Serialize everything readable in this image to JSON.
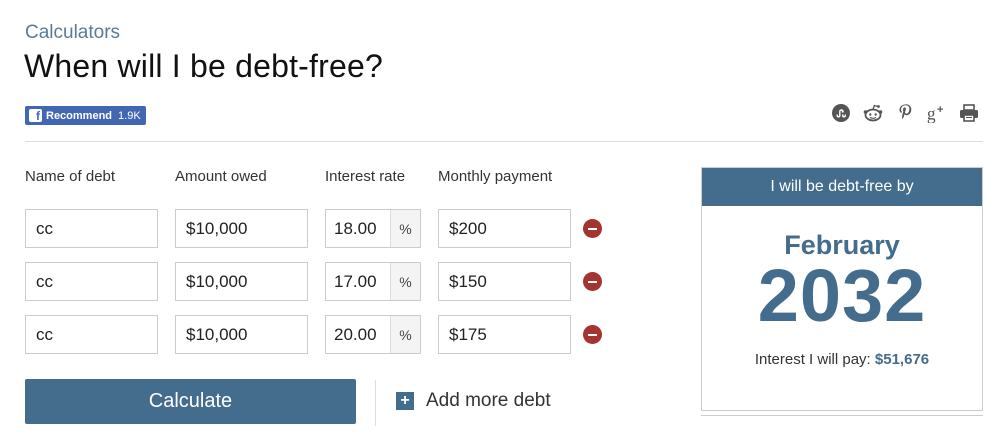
{
  "breadcrumb": "Calculators",
  "title": "When will I be debt-free?",
  "facebook": {
    "label": "Recommend",
    "count": "1.9K",
    "logo": "f"
  },
  "share": [
    "stumbleupon-icon",
    "reddit-icon",
    "pinterest-icon",
    "google-plus-icon",
    "print-icon"
  ],
  "columns": {
    "name": "Name of debt",
    "amount": "Amount owed",
    "rate": "Interest rate",
    "payment": "Monthly payment"
  },
  "rate_unit": "%",
  "debts": [
    {
      "name": "cc",
      "amount": "$10,000",
      "rate": "18.00",
      "payment": "$200"
    },
    {
      "name": "cc",
      "amount": "$10,000",
      "rate": "17.00",
      "payment": "$150"
    },
    {
      "name": "cc",
      "amount": "$10,000",
      "rate": "20.00",
      "payment": "$175"
    }
  ],
  "calculate_label": "Calculate",
  "add_debt_label": "Add more debt",
  "add_icon": "+",
  "result": {
    "header": "I will be debt-free by",
    "month": "February",
    "year": "2032",
    "interest_label": "Interest I will pay:",
    "interest_value": "$51,676"
  },
  "colors": {
    "accent": "#436c8d",
    "remove": "#a3342f",
    "facebook": "#4267b2"
  }
}
